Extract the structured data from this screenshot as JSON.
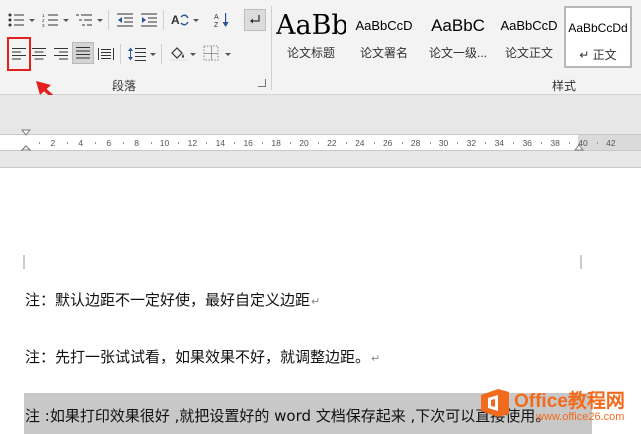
{
  "ribbon": {
    "paragraph_group_label": "段落",
    "styles_group_label": "样式",
    "styles": [
      {
        "sample": "AaBb",
        "name": "论文标题"
      },
      {
        "sample": "AaBbCcD",
        "name": "论文署名"
      },
      {
        "sample": "AaBbC",
        "name": "论文一级..."
      },
      {
        "sample": "AaBbCcD",
        "name": "论文正文"
      },
      {
        "sample": "AaBbCcDd",
        "name": "↵ 正文"
      }
    ]
  },
  "ruler": {
    "ticks": [
      "2",
      "4",
      "6",
      "8",
      "10",
      "12",
      "14",
      "16",
      "18",
      "20",
      "22",
      "24",
      "26",
      "28",
      "30",
      "32",
      "34",
      "36",
      "38",
      "40",
      "42"
    ]
  },
  "document": {
    "paragraphs": [
      "注：默认边距不一定好使，最好自定义边距",
      "注：先打一张试试看，如果效果不好，就调整边距。",
      "注 :如果打印效果很好 ,就把设置好的 word 文档保存起来 ,下次可以直接使用。"
    ]
  },
  "watermark": {
    "title": "Office教程网",
    "url": "www.office26.com"
  },
  "colors": {
    "annotation_red": "#e2201e",
    "watermark_orange": "#f26b1d"
  }
}
